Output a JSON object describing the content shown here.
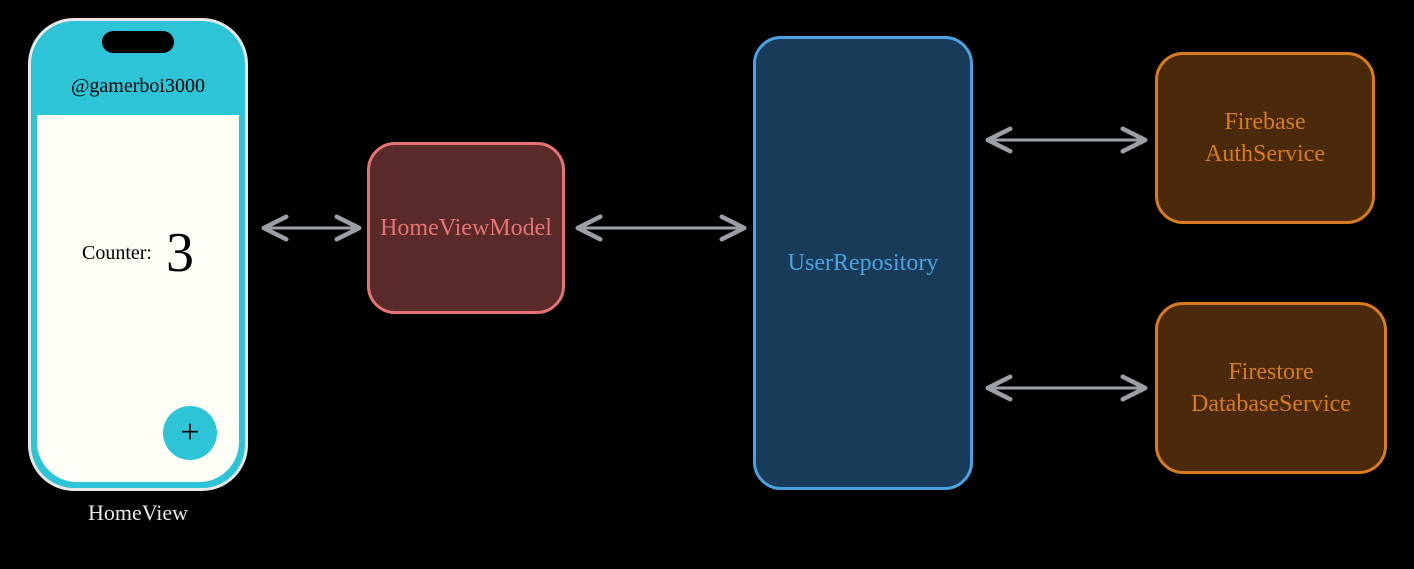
{
  "phone": {
    "username": "@gamerboi3000",
    "counter_label": "Counter:",
    "counter_value": "3",
    "fab_label": "+",
    "caption": "HomeView"
  },
  "boxes": {
    "viewmodel": "HomeViewModel",
    "repository": "UserRepository",
    "auth_line1": "Firebase",
    "auth_line2": "AuthService",
    "db_line1": "Firestore",
    "db_line2": "DatabaseService"
  }
}
